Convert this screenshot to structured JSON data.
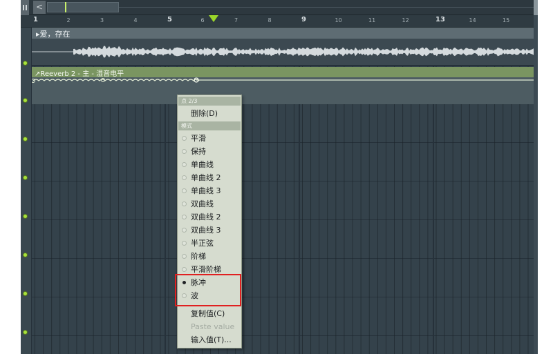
{
  "ruler": {
    "bars": [
      "1",
      "2",
      "3",
      "4",
      "5",
      "6",
      "7",
      "8",
      "9",
      "10",
      "11",
      "12",
      "13",
      "14",
      "15"
    ],
    "big_bars": [
      "1",
      "5",
      "9",
      "13"
    ]
  },
  "tracks": {
    "audio_clip_title": "▸爱，存在",
    "automation_clip_title": "↗Reeverb 2 - 主 - 湿音电平"
  },
  "context_menu": {
    "point_header": "点 2/3",
    "delete_label": "删除(D)",
    "mode_header": "模式",
    "modes": [
      {
        "label": "平滑",
        "selected": false
      },
      {
        "label": "保持",
        "selected": false
      },
      {
        "label": "单曲线",
        "selected": false
      },
      {
        "label": "单曲线 2",
        "selected": false
      },
      {
        "label": "单曲线 3",
        "selected": false
      },
      {
        "label": "双曲线",
        "selected": false
      },
      {
        "label": "双曲线 2",
        "selected": false
      },
      {
        "label": "双曲线 3",
        "selected": false
      },
      {
        "label": "半正弦",
        "selected": false
      },
      {
        "label": "阶梯",
        "selected": false
      },
      {
        "label": "平滑阶梯",
        "selected": false
      },
      {
        "label": "脉冲",
        "selected": true
      },
      {
        "label": "波",
        "selected": false
      }
    ],
    "copy_value": "复制值(C)",
    "paste_value": "Paste value",
    "input_value": "输入值(T)..."
  },
  "colors": {
    "accent_green": "#a8e23d",
    "highlight_box": "#e02020",
    "automation_header": "#7a9561"
  }
}
